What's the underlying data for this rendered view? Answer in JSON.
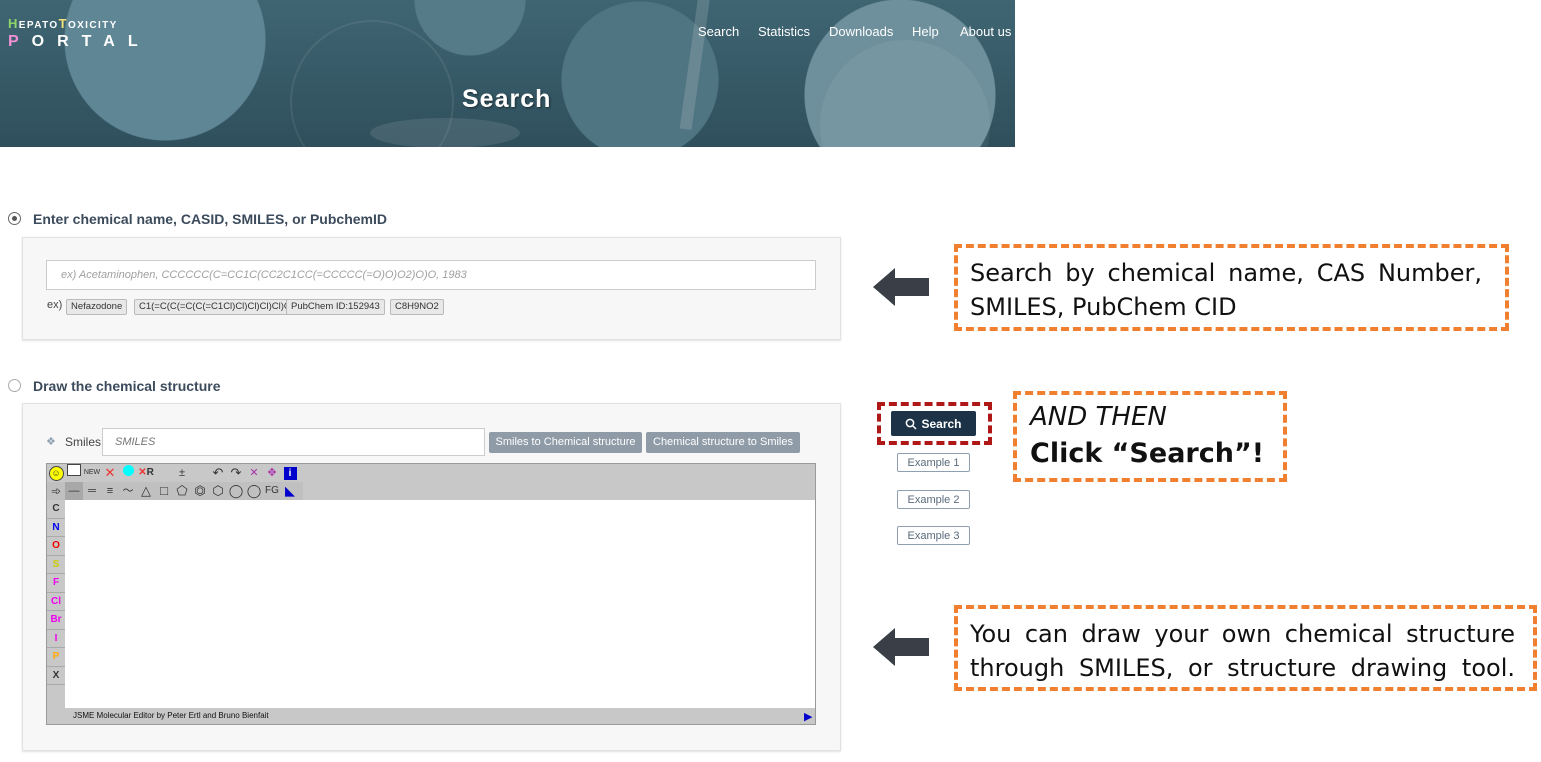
{
  "header": {
    "logo_line1": "HepatoToxicity",
    "logo_line2": "PORTAL",
    "nav": [
      "Search",
      "Statistics",
      "Downloads",
      "Help",
      "About us"
    ],
    "banner_title": "Search"
  },
  "text_search": {
    "label": "Enter chemical name, CASID, SMILES, or PubchemID",
    "selected": true,
    "placeholder": "ex) Acetaminophen, CCCCCC(C=CC1C(CC2C1CC(=CCCCC(=O)O)O2)O)O, 1983",
    "examples_prefix": "ex)",
    "examples": [
      "Nefazodone",
      "C1(=C(C(=C(C(=C1Cl)Cl)Cl)Cl)Cl)O",
      "PubChem ID:152943",
      "C8H9NO2"
    ]
  },
  "draw_search": {
    "label": "Draw the chemical structure",
    "selected": false,
    "smiles_label": "Smiles",
    "smiles_placeholder": "SMILES",
    "btn_smiles_to_structure": "Smiles to Chemical structure",
    "btn_structure_to_smiles": "Chemical structure to Smiles",
    "editor": {
      "toolbar_row1": [
        "NEW",
        "R",
        "±",
        "i"
      ],
      "toolbar_row2": [
        "FG"
      ],
      "atoms": [
        "C",
        "N",
        "O",
        "S",
        "F",
        "Cl",
        "Br",
        "I",
        "P",
        "X"
      ],
      "atom_colors": [
        "#333333",
        "#0000ee",
        "#ee0000",
        "#cccc00",
        "#ee00ee",
        "#ee00ee",
        "#ee00ee",
        "#ee00ee",
        "#ffaa00",
        "#333333"
      ],
      "footer": "JSME Molecular Editor by Peter Ertl and Bruno Bienfait"
    }
  },
  "actions": {
    "search": "Search",
    "examples": [
      "Example 1",
      "Example 2",
      "Example 3"
    ]
  },
  "annotations": {
    "box1": "Search by chemical name, CAS Number, SMILES, PubChem CID",
    "box2_line1": "AND THEN",
    "box2_line2": "Click “Search”!",
    "box3": "You can draw your own chemical structure through SMILES, or structure drawing tool."
  },
  "colors": {
    "annotation_orange": "#f08030",
    "annotation_red": "#b01818",
    "search_button": "#1c3247",
    "secondary_button": "#8f9ba6"
  }
}
